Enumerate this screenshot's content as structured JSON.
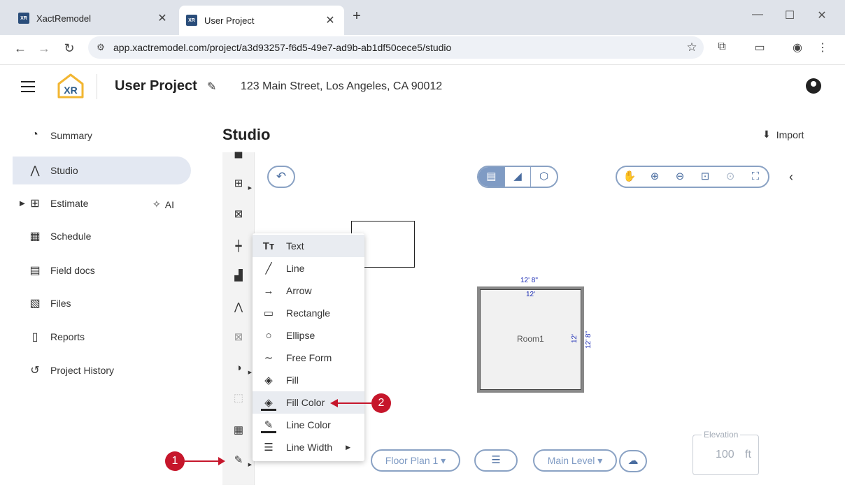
{
  "browser": {
    "tabs": [
      {
        "title": "XactRemodel",
        "active": false
      },
      {
        "title": "User Project",
        "active": true
      }
    ],
    "url": "app.xactremodel.com/project/a3d93257-f6d5-49e7-ad9b-ab1df50cece5/studio",
    "favicon_text": "XR"
  },
  "header": {
    "logo_text": "XR",
    "project_title": "User Project",
    "address": "123 Main Street, Los Angeles, CA 90012"
  },
  "sidebar": {
    "items": [
      {
        "label": "Summary",
        "icon": "gauge-icon"
      },
      {
        "label": "Studio",
        "icon": "compass-icon",
        "selected": true
      },
      {
        "label": "Estimate",
        "icon": "calculator-icon"
      },
      {
        "label": "Schedule",
        "icon": "calendar-icon"
      },
      {
        "label": "Field docs",
        "icon": "clipboard-icon"
      },
      {
        "label": "Files",
        "icon": "images-icon"
      },
      {
        "label": "Reports",
        "icon": "document-icon"
      },
      {
        "label": "Project History",
        "icon": "history-icon"
      }
    ],
    "ai_label": "AI"
  },
  "studio": {
    "title": "Studio",
    "import_label": "Import",
    "floor_plan_label": "Floor Plan 1",
    "level_label": "Main Level",
    "elevation": {
      "label": "Elevation",
      "value": "100",
      "unit": "ft"
    },
    "room": {
      "name": "Room1",
      "dim_top_outer": "12' 8\"",
      "dim_top_inner": "12'",
      "dim_right_inner": "12'",
      "dim_right_outer": "12' 8\""
    }
  },
  "context_menu": {
    "items": [
      {
        "label": "Text",
        "icon": "text-icon",
        "highlighted": true
      },
      {
        "label": "Line",
        "icon": "line-icon"
      },
      {
        "label": "Arrow",
        "icon": "arrow-icon"
      },
      {
        "label": "Rectangle",
        "icon": "rectangle-icon"
      },
      {
        "label": "Ellipse",
        "icon": "ellipse-icon"
      },
      {
        "label": "Free Form",
        "icon": "freeform-icon"
      },
      {
        "label": "Fill",
        "icon": "paint-bucket-icon"
      },
      {
        "label": "Fill Color",
        "icon": "fill-color-icon",
        "highlighted": true
      },
      {
        "label": "Line Color",
        "icon": "line-color-icon"
      },
      {
        "label": "Line Width",
        "icon": "line-width-icon",
        "submenu": true
      }
    ]
  },
  "annotations": {
    "marker_1": "1",
    "marker_2": "2",
    "color": "#c6162b"
  },
  "colors": {
    "accent": "#7f9bc4",
    "selected_nav": "#e3e8f2",
    "dimension_text": "#1a2bb5"
  }
}
